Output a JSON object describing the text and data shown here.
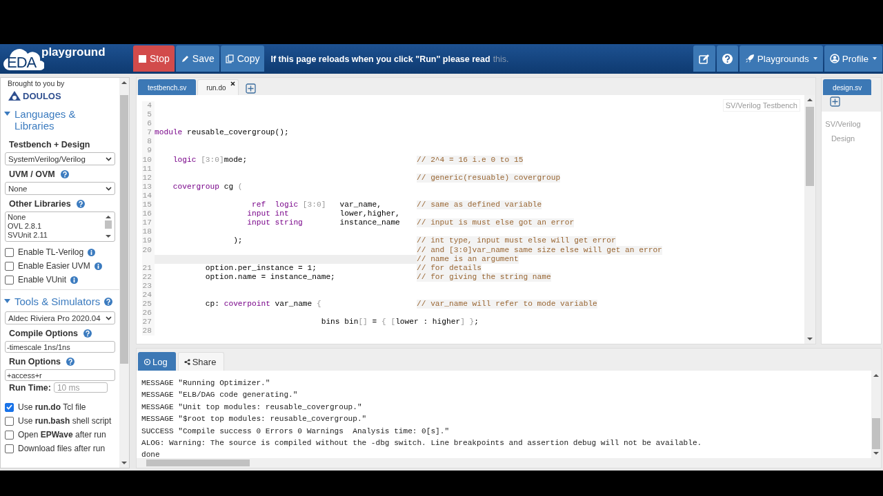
{
  "navbar": {
    "logo": {
      "badge": "EDA",
      "name": "playground"
    },
    "buttons": [
      {
        "kind": "stop",
        "label": "Stop"
      },
      {
        "kind": "save",
        "label": "Save"
      },
      {
        "kind": "copy",
        "label": "Copy"
      }
    ],
    "notice": {
      "text": "If this page reloads when you click \"Run\" please read",
      "link": "this."
    },
    "right": [
      {
        "kind": "edit"
      },
      {
        "kind": "help"
      },
      {
        "kind": "menu",
        "label": "Playgrounds"
      },
      {
        "kind": "menu",
        "label": "Profile"
      }
    ]
  },
  "sidebar": {
    "brought_by": "Brought to you by",
    "brand": "DOULOS",
    "items": [
      {
        "kind": "section",
        "label": "Languages & Libraries",
        "expanded": true,
        "help": false
      },
      {
        "kind": "label",
        "label": "Testbench + Design",
        "help": false
      },
      {
        "kind": "select",
        "value": "SystemVerilog/Verilog"
      },
      {
        "kind": "label",
        "label": "UVM / OVM",
        "help": true
      },
      {
        "kind": "select",
        "value": "None"
      },
      {
        "kind": "label",
        "label": "Other Libraries",
        "help": true
      },
      {
        "kind": "listbox",
        "options": [
          "None",
          "OVL 2.8.1",
          "SVUnit 2.11"
        ]
      },
      {
        "kind": "checkbox",
        "label": "Enable TL-Verilog",
        "checked": false,
        "info": true
      },
      {
        "kind": "checkbox",
        "label": "Enable Easier UVM",
        "checked": false,
        "info": true
      },
      {
        "kind": "checkbox",
        "label": "Enable VUnit",
        "checked": false,
        "info": true
      },
      {
        "kind": "section",
        "label": "Tools & Simulators",
        "expanded": true,
        "help": true
      },
      {
        "kind": "select",
        "value": "Aldec Riviera Pro 2020.04"
      },
      {
        "kind": "label",
        "label": "Compile Options",
        "help": true
      },
      {
        "kind": "input",
        "value": "-timescale 1ns/1ns"
      },
      {
        "kind": "label",
        "label": "Run Options",
        "help": true
      },
      {
        "kind": "input",
        "value": "+access+r"
      },
      {
        "kind": "field_row",
        "label": "Run Time:",
        "placeholder": "10 ms"
      },
      {
        "kind": "checkbox",
        "label": "Use **run.do** Tcl file",
        "checked": true,
        "info": false
      },
      {
        "kind": "checkbox",
        "label": "Use **run.bash** shell script",
        "checked": false,
        "info": false
      },
      {
        "kind": "checkbox",
        "label": "Open **EPWave** after run",
        "checked": false,
        "info": false
      },
      {
        "kind": "checkbox",
        "label": "Download files after run",
        "checked": false,
        "info": false
      }
    ]
  },
  "editor": {
    "tabs": [
      {
        "label": "testbench.sv",
        "selected": true,
        "closable": false
      },
      {
        "label": "run.do",
        "selected": false,
        "closable": true
      }
    ],
    "mode_label": "SV/Verilog Testbench",
    "lines": [
      {
        "num": "4",
        "highlighted": false
      },
      {
        "num": "5",
        "highlighted": false
      },
      {
        "num": "6",
        "highlighted": false
      },
      {
        "num": "7",
        "highlighted": false,
        "tokens": [
          {
            "kind": "kw",
            "text": "module"
          },
          {
            "kind": "plain",
            "text": " reusable_covergroup();"
          }
        ]
      },
      {
        "num": "8",
        "highlighted": false
      },
      {
        "num": "9",
        "highlighted": false
      },
      {
        "num": "10",
        "highlighted": false,
        "tokens": [
          {
            "kind": "kw",
            "text": "    logic "
          },
          {
            "kind": "dim",
            "text": "[3:0]"
          },
          {
            "kind": "plain",
            "text": "mode;"
          }
        ],
        "comment": "// 2^4 = 16 i.e 0 to 15"
      },
      {
        "num": "11",
        "highlighted": false
      },
      {
        "num": "12",
        "highlighted": false,
        "comment": "// generic(resuable) covergroup"
      },
      {
        "num": "13",
        "highlighted": false,
        "tokens": [
          {
            "kind": "kw",
            "text": "    covergroup"
          },
          {
            "kind": "plain",
            "text": " cg "
          },
          {
            "kind": "dim",
            "text": "("
          }
        ]
      },
      {
        "num": "14",
        "highlighted": false
      },
      {
        "num": "15",
        "highlighted": false,
        "tokens": [
          {
            "kind": "kw",
            "text": "                     ref  logic "
          },
          {
            "kind": "dim",
            "text": "[3:0]"
          },
          {
            "kind": "plain",
            "text": "   var_name,"
          }
        ],
        "comment": "// same as defined variable"
      },
      {
        "num": "16",
        "highlighted": false,
        "tokens": [
          {
            "kind": "kw",
            "text": "                    input int"
          },
          {
            "kind": "plain",
            "text": "           lower,higher,"
          }
        ]
      },
      {
        "num": "17",
        "highlighted": false,
        "tokens": [
          {
            "kind": "kw",
            "text": "                    input string"
          },
          {
            "kind": "plain",
            "text": "        instance_name"
          }
        ],
        "comment": "// input is must else got an error"
      },
      {
        "num": "18",
        "highlighted": false
      },
      {
        "num": "19",
        "highlighted": false,
        "tokens": [
          {
            "kind": "plain",
            "text": "                 );"
          }
        ],
        "comment": "// int type, input must else will get error"
      },
      {
        "num": "20",
        "highlighted": false,
        "comment": "// and [3:0]var_name same size else will get an error"
      },
      {
        "highlighted": true,
        "comment": "// name is an argument"
      },
      {
        "num": "21",
        "highlighted": false,
        "tokens": [
          {
            "kind": "plain",
            "text": "           option.per_instance = 1;"
          }
        ],
        "comment": "// for details"
      },
      {
        "num": "22",
        "highlighted": false,
        "tokens": [
          {
            "kind": "plain",
            "text": "           option.name = instance_name;"
          }
        ],
        "comment": "// for giving the string name"
      },
      {
        "num": "23",
        "highlighted": false
      },
      {
        "num": "24",
        "highlighted": false
      },
      {
        "num": "25",
        "highlighted": false,
        "tokens": [
          {
            "kind": "plain",
            "text": "           cp: "
          },
          {
            "kind": "kw",
            "text": "coverpoint"
          },
          {
            "kind": "plain",
            "text": " var_name "
          },
          {
            "kind": "dim",
            "text": "{"
          }
        ],
        "comment": "// var_name will refer to mode variable"
      },
      {
        "num": "26",
        "highlighted": false
      },
      {
        "num": "27",
        "highlighted": false,
        "tokens": [
          {
            "kind": "plain",
            "text": "                                    bins bin"
          },
          {
            "kind": "dim",
            "text": "[]"
          },
          {
            "kind": "plain",
            "text": " = "
          },
          {
            "kind": "dim",
            "text": "{ ["
          },
          {
            "kind": "plain",
            "text": "lower : higher"
          },
          {
            "kind": "dim",
            "text": "] }"
          },
          {
            "kind": "plain",
            "text": ";"
          }
        ]
      },
      {
        "num": "28",
        "highlighted": false
      }
    ]
  },
  "design": {
    "tabs": [
      {
        "label": "design.sv",
        "selected": true
      }
    ],
    "mode_label": "SV/Verilog Design"
  },
  "log": {
    "tabs": [
      {
        "label": "Log",
        "selected": true
      },
      {
        "label": "Share",
        "selected": false
      }
    ],
    "lines": [
      "MESSAGE \"Running Optimizer.\"",
      "MESSAGE \"ELB/DAG code generating.\"",
      "MESSAGE \"Unit top modules: reusable_covergroup.\"",
      "MESSAGE \"$root top modules: reusable_covergroup.\"",
      "SUCCESS \"Compile success 0 Errors 0 Warnings  Analysis time: 0[s].\"",
      "ALOG: Warning: The source is compiled without the -dbg switch. Line breakpoints and assertion debug will not be available.",
      "done"
    ]
  }
}
